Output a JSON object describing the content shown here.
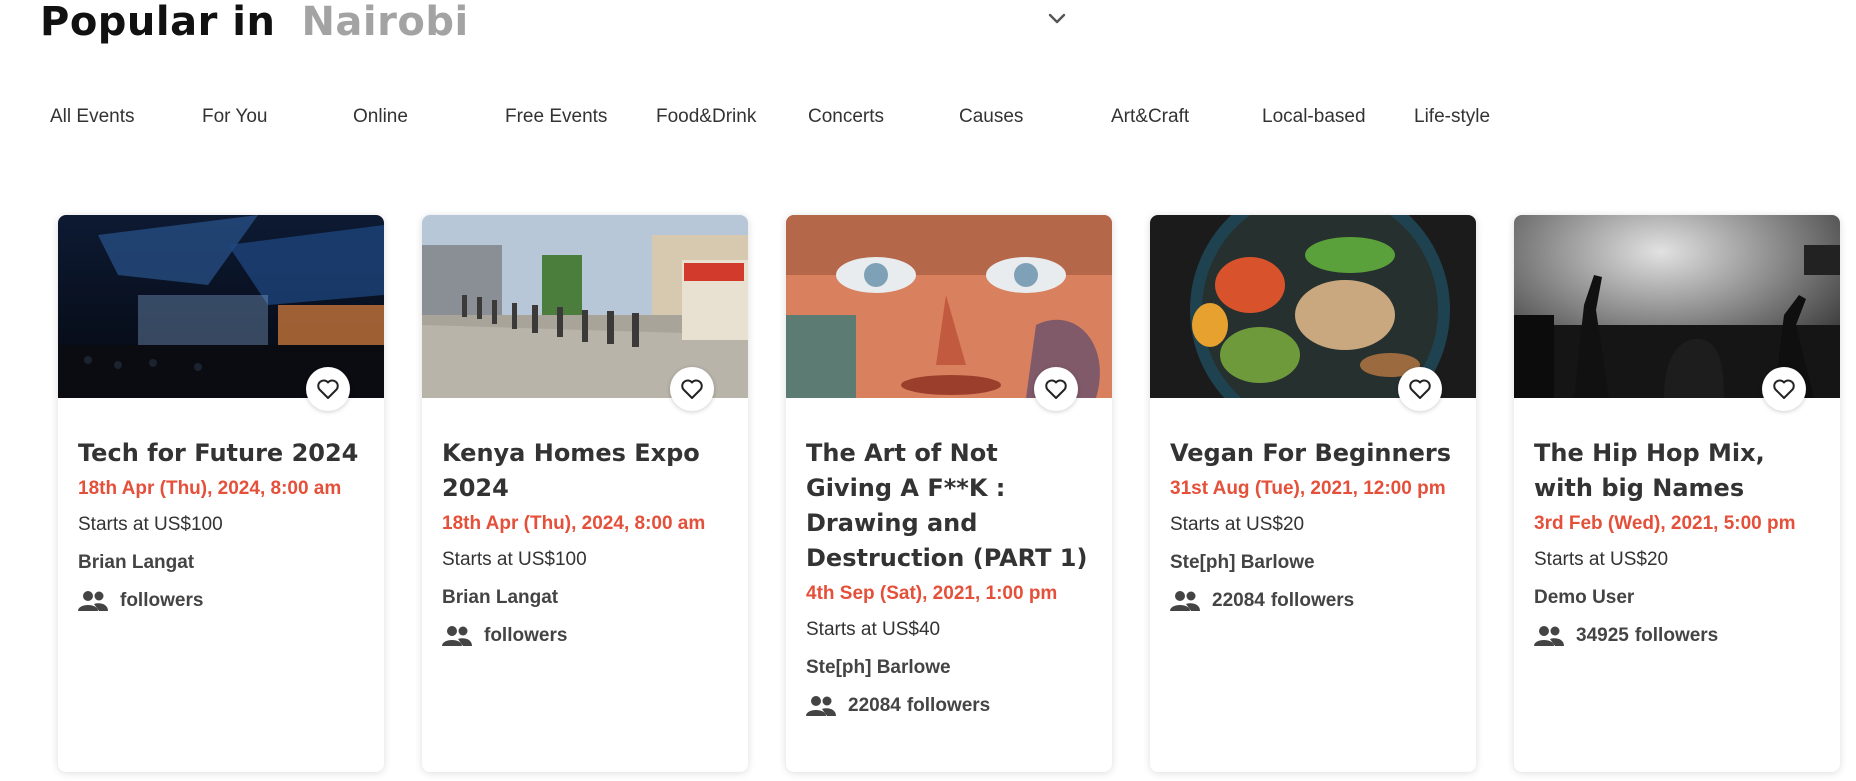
{
  "header": {
    "title": "Popular in",
    "city": "Nairobi",
    "chevron_icon": "chevron-down-icon"
  },
  "tabs": [
    {
      "label": "All Events"
    },
    {
      "label": "For You"
    },
    {
      "label": "Online"
    },
    {
      "label": "Free Events"
    },
    {
      "label": "Food&Drink"
    },
    {
      "label": "Concerts"
    },
    {
      "label": "Causes"
    },
    {
      "label": "Art&Craft"
    },
    {
      "label": "Local-based"
    },
    {
      "label": "Life-style"
    }
  ],
  "cards": [
    {
      "title": "Tech for Future 2024",
      "date": "18th Apr (Thu), 2024, 8:00 am",
      "price": "Starts at US$100",
      "organizer": "Brian Langat",
      "followers_count": "",
      "followers_label": "followers",
      "image": "conference-stage-photo"
    },
    {
      "title": "Kenya Homes Expo 2024",
      "date": "18th Apr (Thu), 2024, 8:00 am",
      "price": "Starts at US$100",
      "organizer": "Brian Langat",
      "followers_count": "",
      "followers_label": "followers",
      "image": "expo-queue-photo"
    },
    {
      "title": "The Art of Not Giving A F**K : Drawing and Destruction (PART 1)",
      "date": "4th Sep (Sat), 2021, 1:00 pm",
      "price": "Starts at US$40",
      "organizer": "Ste[ph] Barlowe",
      "followers_count": "22084",
      "followers_label": "followers",
      "image": "graffiti-face-photo"
    },
    {
      "title": "Vegan For Beginners",
      "date": "31st Aug (Tue), 2021, 12:00 pm",
      "price": "Starts at US$20",
      "organizer": "Ste[ph] Barlowe",
      "followers_count": "22084",
      "followers_label": "followers",
      "image": "vegan-bowl-photo"
    },
    {
      "title": "The Hip Hop Mix, with big Names",
      "date": "3rd Feb (Wed), 2021, 5:00 pm",
      "price": "Starts at US$20",
      "organizer": "Demo User",
      "followers_count": "34925",
      "followers_label": "followers",
      "image": "concert-crowd-photo"
    }
  ],
  "icons": {
    "favorite": "heart-icon",
    "followers": "people-icon"
  },
  "colors": {
    "date": "#e4503a",
    "city": "#a3a3a3",
    "title": "#111111"
  }
}
